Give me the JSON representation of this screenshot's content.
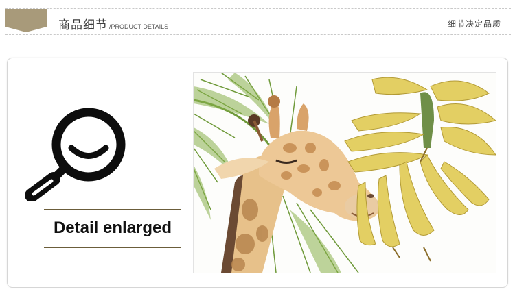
{
  "header": {
    "title_cn": "商品细节",
    "title_en": "/PRODUCT DETAILS",
    "slogan": "细节决定品质",
    "tag_color": "#a89a7a",
    "rule_color": "#c9c9c9"
  },
  "detail": {
    "caption": "Detail enlarged",
    "icon": "magnifier-icon",
    "line_color": "#6b5d3a",
    "photo_subject": "giraffe-eating-bananas-illustration"
  }
}
